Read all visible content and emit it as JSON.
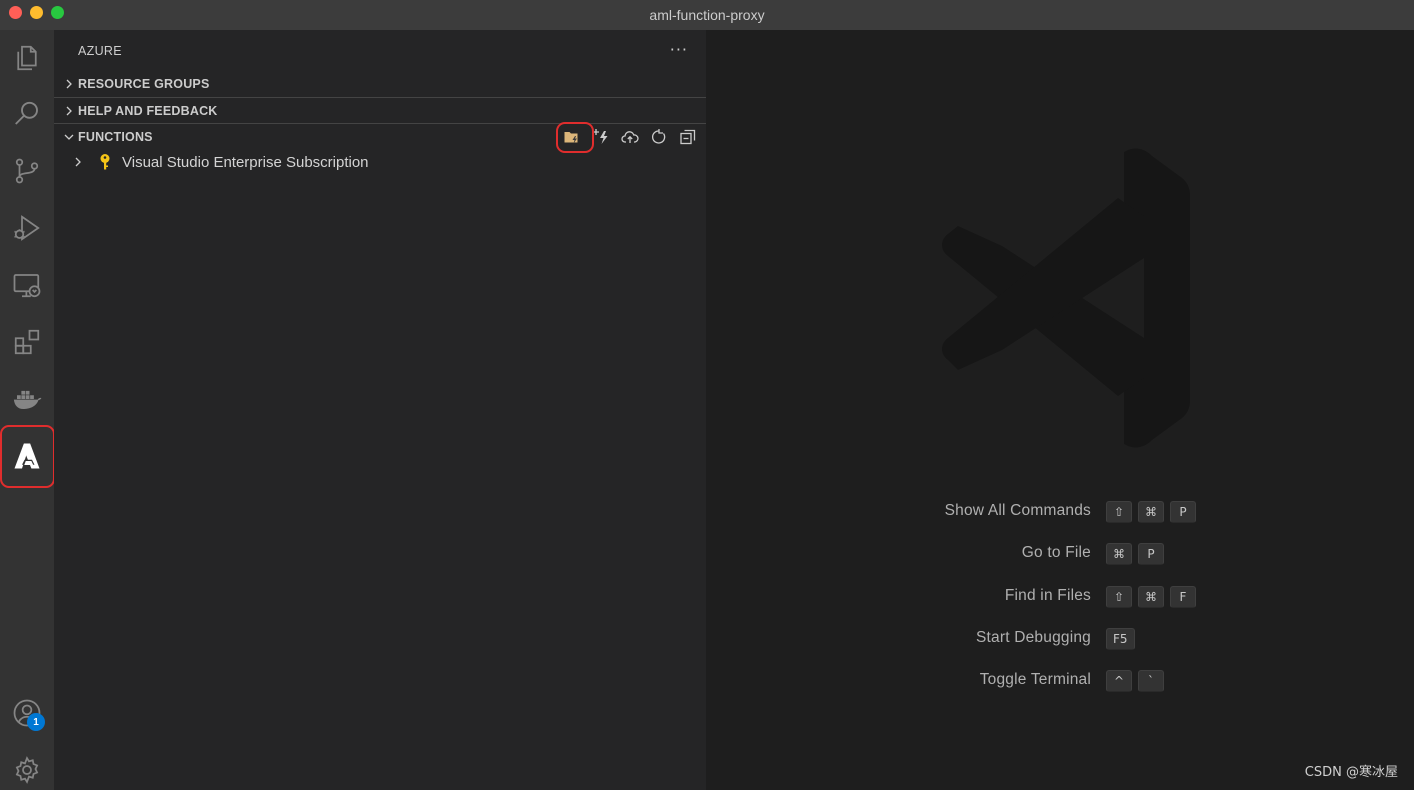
{
  "window": {
    "title": "aml-function-proxy"
  },
  "activity_bar": {
    "items": [
      {
        "icon": "files-icon"
      },
      {
        "icon": "search-icon"
      },
      {
        "icon": "source-control-icon"
      },
      {
        "icon": "run-debug-icon"
      },
      {
        "icon": "remote-explorer-icon"
      },
      {
        "icon": "extensions-icon"
      },
      {
        "icon": "docker-icon"
      },
      {
        "icon": "azure-icon",
        "active": true,
        "highlighted": true
      }
    ],
    "accounts_badge": "1"
  },
  "sidebar": {
    "header": "AZURE",
    "more_actions": "···",
    "sections": [
      {
        "label": "RESOURCE GROUPS",
        "expanded": false
      },
      {
        "label": "HELP AND FEEDBACK",
        "expanded": false
      },
      {
        "label": "FUNCTIONS",
        "expanded": true
      }
    ],
    "functions_actions": [
      "create-new-project-icon",
      "create-function-icon",
      "deploy-icon",
      "refresh-icon",
      "collapse-all-icon"
    ],
    "tree": [
      {
        "label": "Visual Studio Enterprise Subscription",
        "icon": "key-icon",
        "expanded": false
      }
    ]
  },
  "editor": {
    "shortcuts": [
      {
        "label": "Show All Commands",
        "keys": [
          "⇧",
          "⌘",
          "P"
        ]
      },
      {
        "label": "Go to File",
        "keys": [
          "⌘",
          "P"
        ]
      },
      {
        "label": "Find in Files",
        "keys": [
          "⇧",
          "⌘",
          "F"
        ]
      },
      {
        "label": "Start Debugging",
        "keys": [
          "F5"
        ]
      },
      {
        "label": "Toggle Terminal",
        "keys": [
          "^",
          "`"
        ]
      }
    ],
    "watermark": "CSDN @寒冰屋"
  },
  "colors": {
    "highlight": "#e02d2d",
    "badge": "#0078d4",
    "folder": "#dcb67a",
    "key": "#f5c518"
  }
}
